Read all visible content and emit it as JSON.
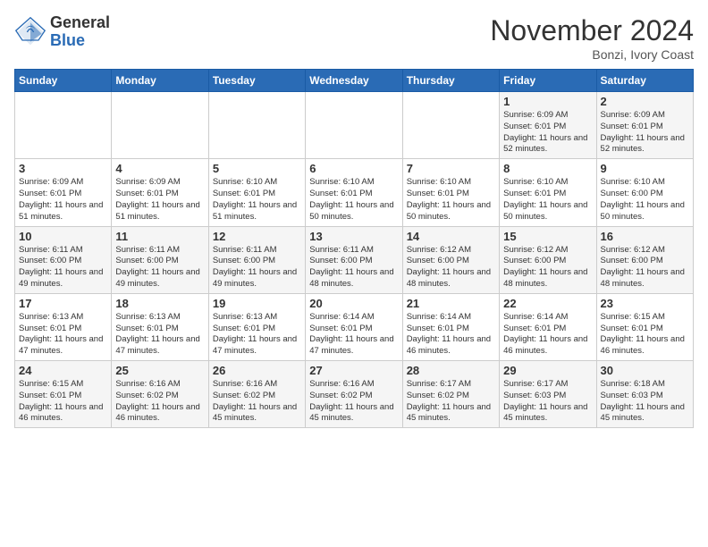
{
  "header": {
    "logo_general": "General",
    "logo_blue": "Blue",
    "month_title": "November 2024",
    "location": "Bonzi, Ivory Coast"
  },
  "weekdays": [
    "Sunday",
    "Monday",
    "Tuesday",
    "Wednesday",
    "Thursday",
    "Friday",
    "Saturday"
  ],
  "weeks": [
    [
      {
        "day": "",
        "info": ""
      },
      {
        "day": "",
        "info": ""
      },
      {
        "day": "",
        "info": ""
      },
      {
        "day": "",
        "info": ""
      },
      {
        "day": "",
        "info": ""
      },
      {
        "day": "1",
        "info": "Sunrise: 6:09 AM\nSunset: 6:01 PM\nDaylight: 11 hours\nand 52 minutes."
      },
      {
        "day": "2",
        "info": "Sunrise: 6:09 AM\nSunset: 6:01 PM\nDaylight: 11 hours\nand 52 minutes."
      }
    ],
    [
      {
        "day": "3",
        "info": "Sunrise: 6:09 AM\nSunset: 6:01 PM\nDaylight: 11 hours\nand 51 minutes."
      },
      {
        "day": "4",
        "info": "Sunrise: 6:09 AM\nSunset: 6:01 PM\nDaylight: 11 hours\nand 51 minutes."
      },
      {
        "day": "5",
        "info": "Sunrise: 6:10 AM\nSunset: 6:01 PM\nDaylight: 11 hours\nand 51 minutes."
      },
      {
        "day": "6",
        "info": "Sunrise: 6:10 AM\nSunset: 6:01 PM\nDaylight: 11 hours\nand 50 minutes."
      },
      {
        "day": "7",
        "info": "Sunrise: 6:10 AM\nSunset: 6:01 PM\nDaylight: 11 hours\nand 50 minutes."
      },
      {
        "day": "8",
        "info": "Sunrise: 6:10 AM\nSunset: 6:01 PM\nDaylight: 11 hours\nand 50 minutes."
      },
      {
        "day": "9",
        "info": "Sunrise: 6:10 AM\nSunset: 6:00 PM\nDaylight: 11 hours\nand 50 minutes."
      }
    ],
    [
      {
        "day": "10",
        "info": "Sunrise: 6:11 AM\nSunset: 6:00 PM\nDaylight: 11 hours\nand 49 minutes."
      },
      {
        "day": "11",
        "info": "Sunrise: 6:11 AM\nSunset: 6:00 PM\nDaylight: 11 hours\nand 49 minutes."
      },
      {
        "day": "12",
        "info": "Sunrise: 6:11 AM\nSunset: 6:00 PM\nDaylight: 11 hours\nand 49 minutes."
      },
      {
        "day": "13",
        "info": "Sunrise: 6:11 AM\nSunset: 6:00 PM\nDaylight: 11 hours\nand 48 minutes."
      },
      {
        "day": "14",
        "info": "Sunrise: 6:12 AM\nSunset: 6:00 PM\nDaylight: 11 hours\nand 48 minutes."
      },
      {
        "day": "15",
        "info": "Sunrise: 6:12 AM\nSunset: 6:00 PM\nDaylight: 11 hours\nand 48 minutes."
      },
      {
        "day": "16",
        "info": "Sunrise: 6:12 AM\nSunset: 6:00 PM\nDaylight: 11 hours\nand 48 minutes."
      }
    ],
    [
      {
        "day": "17",
        "info": "Sunrise: 6:13 AM\nSunset: 6:01 PM\nDaylight: 11 hours\nand 47 minutes."
      },
      {
        "day": "18",
        "info": "Sunrise: 6:13 AM\nSunset: 6:01 PM\nDaylight: 11 hours\nand 47 minutes."
      },
      {
        "day": "19",
        "info": "Sunrise: 6:13 AM\nSunset: 6:01 PM\nDaylight: 11 hours\nand 47 minutes."
      },
      {
        "day": "20",
        "info": "Sunrise: 6:14 AM\nSunset: 6:01 PM\nDaylight: 11 hours\nand 47 minutes."
      },
      {
        "day": "21",
        "info": "Sunrise: 6:14 AM\nSunset: 6:01 PM\nDaylight: 11 hours\nand 46 minutes."
      },
      {
        "day": "22",
        "info": "Sunrise: 6:14 AM\nSunset: 6:01 PM\nDaylight: 11 hours\nand 46 minutes."
      },
      {
        "day": "23",
        "info": "Sunrise: 6:15 AM\nSunset: 6:01 PM\nDaylight: 11 hours\nand 46 minutes."
      }
    ],
    [
      {
        "day": "24",
        "info": "Sunrise: 6:15 AM\nSunset: 6:01 PM\nDaylight: 11 hours\nand 46 minutes."
      },
      {
        "day": "25",
        "info": "Sunrise: 6:16 AM\nSunset: 6:02 PM\nDaylight: 11 hours\nand 46 minutes."
      },
      {
        "day": "26",
        "info": "Sunrise: 6:16 AM\nSunset: 6:02 PM\nDaylight: 11 hours\nand 45 minutes."
      },
      {
        "day": "27",
        "info": "Sunrise: 6:16 AM\nSunset: 6:02 PM\nDaylight: 11 hours\nand 45 minutes."
      },
      {
        "day": "28",
        "info": "Sunrise: 6:17 AM\nSunset: 6:02 PM\nDaylight: 11 hours\nand 45 minutes."
      },
      {
        "day": "29",
        "info": "Sunrise: 6:17 AM\nSunset: 6:03 PM\nDaylight: 11 hours\nand 45 minutes."
      },
      {
        "day": "30",
        "info": "Sunrise: 6:18 AM\nSunset: 6:03 PM\nDaylight: 11 hours\nand 45 minutes."
      }
    ]
  ]
}
